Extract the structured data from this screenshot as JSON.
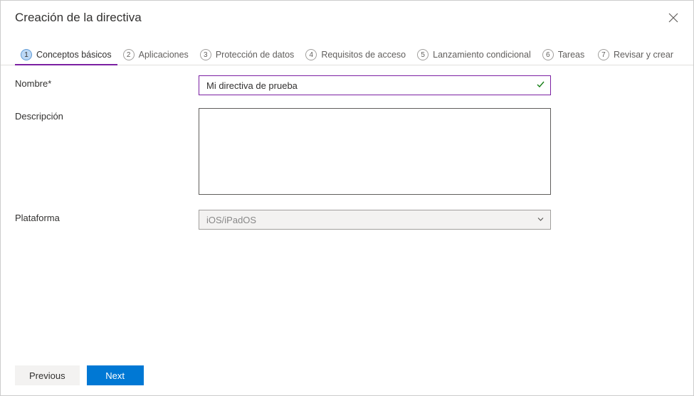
{
  "header": {
    "title": "Creación de la directiva"
  },
  "tabs": {
    "items": [
      {
        "num": "1",
        "label": "Conceptos básicos"
      },
      {
        "num": "2",
        "label": "Aplicaciones"
      },
      {
        "num": "3",
        "label": "Protección de datos"
      },
      {
        "num": "4",
        "label": "Requisitos de acceso"
      },
      {
        "num": "5",
        "label": "Lanzamiento condicional"
      },
      {
        "num": "6",
        "label": "Tareas"
      },
      {
        "num": "7",
        "label": "Revisar y crear"
      }
    ]
  },
  "form": {
    "name": {
      "label": "Nombre*",
      "value": "Mi directiva de prueba"
    },
    "description": {
      "label": "Descripción",
      "value": ""
    },
    "platform": {
      "label": "Plataforma",
      "value": "iOS/iPadOS"
    }
  },
  "footer": {
    "previous": "Previous",
    "next": "Next"
  }
}
